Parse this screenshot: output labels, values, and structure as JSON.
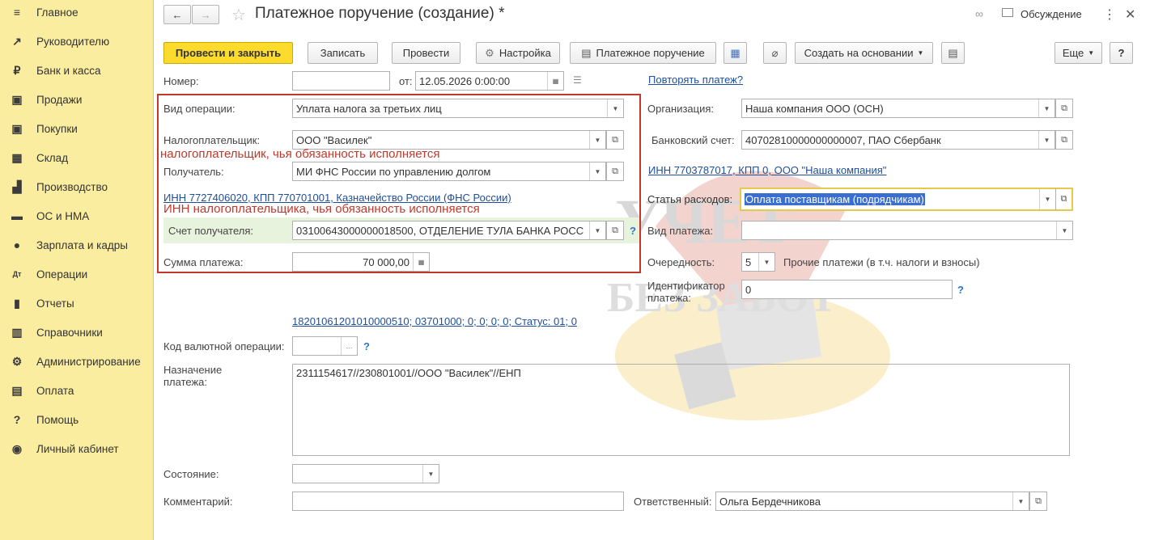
{
  "sidebar": {
    "items": [
      {
        "label": "Главное",
        "icon": "menu-icon",
        "glyph": "≡"
      },
      {
        "label": "Руководителю",
        "icon": "chart-trend-icon",
        "glyph": "↗"
      },
      {
        "label": "Банк и касса",
        "icon": "ruble-coin-icon",
        "glyph": "₽"
      },
      {
        "label": "Продажи",
        "icon": "bag-icon",
        "glyph": "▣"
      },
      {
        "label": "Покупки",
        "icon": "cart-icon",
        "glyph": "🛒"
      },
      {
        "label": "Склад",
        "icon": "warehouse-icon",
        "glyph": "▦"
      },
      {
        "label": "Производство",
        "icon": "factory-icon",
        "glyph": "▟"
      },
      {
        "label": "ОС и НМА",
        "icon": "truck-icon",
        "glyph": "▬"
      },
      {
        "label": "Зарплата и кадры",
        "icon": "person-icon",
        "glyph": "●"
      },
      {
        "label": "Операции",
        "icon": "dt-kt-icon",
        "glyph": "Дт"
      },
      {
        "label": "Отчеты",
        "icon": "bar-chart-icon",
        "glyph": "▮"
      },
      {
        "label": "Справочники",
        "icon": "books-icon",
        "glyph": "▥"
      },
      {
        "label": "Администрирование",
        "icon": "gear-icon",
        "glyph": "⚙"
      },
      {
        "label": "Оплата",
        "icon": "payment-icon",
        "glyph": "▤"
      },
      {
        "label": "Помощь",
        "icon": "question-icon",
        "glyph": "?"
      },
      {
        "label": "Личный кабинет",
        "icon": "account-icon",
        "glyph": "◉"
      }
    ]
  },
  "header": {
    "title": "Платежное поручение (создание) *",
    "back": "←",
    "forward": "→",
    "star": "☆",
    "link_glyph": "🔗",
    "discussion": "Обсуждение",
    "more_glyph": "⋮",
    "close_glyph": "✕"
  },
  "toolbar": {
    "post_close": "Провести и закрыть",
    "save": "Записать",
    "post": "Провести",
    "settings": "Настройка",
    "print": "Платежное поручение",
    "create_based": "Создать на основании",
    "more": "Еще",
    "help": "?"
  },
  "form": {
    "number_label": "Номер:",
    "number_value": "",
    "date_label": "от:",
    "date_value": "12.05.2026  0:00:00",
    "repeat_link": "Повторять платеж?",
    "operation_label": "Вид операции:",
    "operation_value": "Уплата налога за третьих лиц",
    "taxpayer_label": "Налогоплательщик:",
    "taxpayer_value": "ООО \"Василек\"",
    "taxpayer_note": "налогоплательщик, чья обязанность исполняется",
    "recipient_label": "Получатель:",
    "recipient_value": "МИ ФНС России по управлению долгом",
    "recipient_inn_link": "ИНН 7727406020, КПП 770701001, Казначейство России (ФНС России)",
    "inn_note": "ИНН налогоплательщика, чья обязанность исполняется",
    "recipient_account_label": "Счет получателя:",
    "recipient_account_value": "03100643000000018500, ОТДЕЛЕНИЕ ТУЛА БАНКА РОСС",
    "amount_label": "Сумма платежа:",
    "amount_value": "70 000,00",
    "org_label": "Организация:",
    "org_value": "Наша компания ООО (ОСН)",
    "bank_account_label": "Банковский счет:",
    "bank_account_value": "40702810000000000007, ПАО Сбербанк",
    "org_inn_link": "ИНН 7703787017, КПП 0, ООО \"Наша компания\"",
    "expense_label": "Статья расходов:",
    "expense_value": "Оплата поставщикам (подрядчикам)",
    "payment_type_label": "Вид платежа:",
    "payment_type_value": "",
    "priority_label": "Очередность:",
    "priority_value": "5",
    "priority_desc": "Прочие платежи (в т.ч. налоги и взносы)",
    "payment_id_label_1": "Идентификатор",
    "payment_id_label_2": "платежа:",
    "payment_id_value": "0",
    "tax_details_link": "18201061201010000510; 03701000; 0; 0; 0; 0; Статус: 01; 0",
    "currency_label": "Код валютной операции:",
    "currency_value": "",
    "purpose_label_1": "Назначение",
    "purpose_label_2": "платежа:",
    "purpose_value": "2311154617//230801001//ООО \"Василек\"//ЕНП",
    "state_label": "Состояние:",
    "state_value": "",
    "comment_label": "Комментарий:",
    "comment_value": "",
    "responsible_label": "Ответственный:",
    "responsible_value": "Ольга Бердечникова",
    "help_glyph": "?"
  },
  "colors": {
    "sidebar_bg": "#fbeda0",
    "primary_button": "#fcdb2c",
    "highlight_box": "#c0392b",
    "link": "#1f4e9a",
    "selection": "#3a6fd0",
    "focus_border": "#e6c84a",
    "account_row_bg": "#e7f3dc"
  }
}
